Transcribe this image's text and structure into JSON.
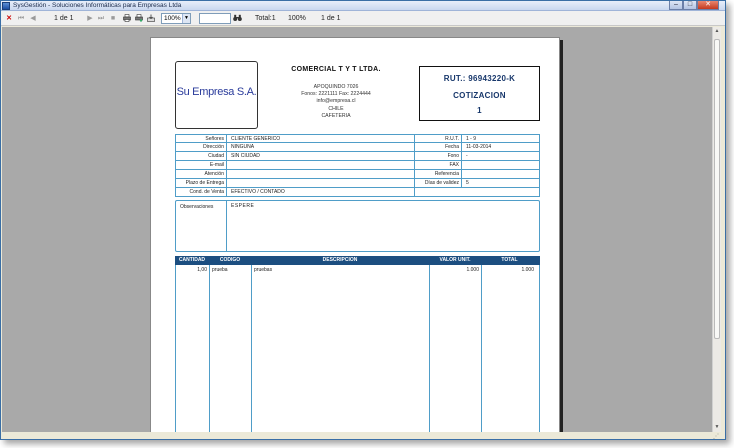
{
  "window": {
    "title": "SysGestión - Soluciones Informáticas para Empresas Ltda",
    "min_glyph": "–",
    "max_glyph": "□",
    "close_glyph": "✕"
  },
  "toolbar": {
    "close_glyph": "✕",
    "first_glyph": "⏮",
    "prev_glyph": "◀",
    "page_counter": "1 de 1",
    "next_glyph": "▶",
    "last_glyph": "⏭",
    "stop_glyph": "■",
    "zoom_value": "100%",
    "total_label": "Total:1",
    "zoom_status": "100%",
    "page_status": "1 de 1"
  },
  "document": {
    "logo_text": "Su Empresa S.A.",
    "company_name": "COMERCIAL T Y T LTDA.",
    "address_lines": [
      "APOQUINDO 7026",
      "Fonos: 2221111     Fax: 2224444",
      "info@empresa.cl",
      "CHILE",
      "CAFETERIA"
    ],
    "rut": "RUT.: 96943220-K",
    "doc_type": "COTIZACION",
    "doc_number": "1",
    "fields": {
      "senores_label": "Señores",
      "senores_value": "CLIENTE GENERICO",
      "direccion_label": "Dirección",
      "direccion_value": "NINGUNA",
      "ciudad_label": "Ciudad",
      "ciudad_value": "SIN CIUDAD",
      "email_label": "E-mail",
      "email_value": "",
      "atencion_label": "Atención",
      "atencion_value": "",
      "plazo_label": "Plazo de Entrega",
      "plazo_value": "",
      "cond_label": "Cond. de Venta",
      "cond_value": "EFECTIVO / CONTADO",
      "rut_label": "R.U.T.",
      "rut_value": "1          -  9",
      "fecha_label": "Fecha",
      "fecha_value": "11-03-2014",
      "fono_label": "Fono",
      "fono_value": "-",
      "fax_label": "FAX",
      "fax_value": "",
      "referencia_label": "Referencia",
      "referencia_value": "",
      "validez_label": "Días de validez",
      "validez_value": "5"
    },
    "observaciones_label": "Observaciones",
    "observaciones_value": "ESPERE",
    "items_headers": [
      "CANTIDAD",
      "CODIGO",
      "DESCRIPCION",
      "VALOR UNIT.",
      "TOTAL"
    ],
    "items": [
      {
        "cantidad": "1,00",
        "codigo": "prueba",
        "descripcion": "pruebas",
        "valor_unit": "1.000",
        "total": "1.000"
      }
    ]
  }
}
